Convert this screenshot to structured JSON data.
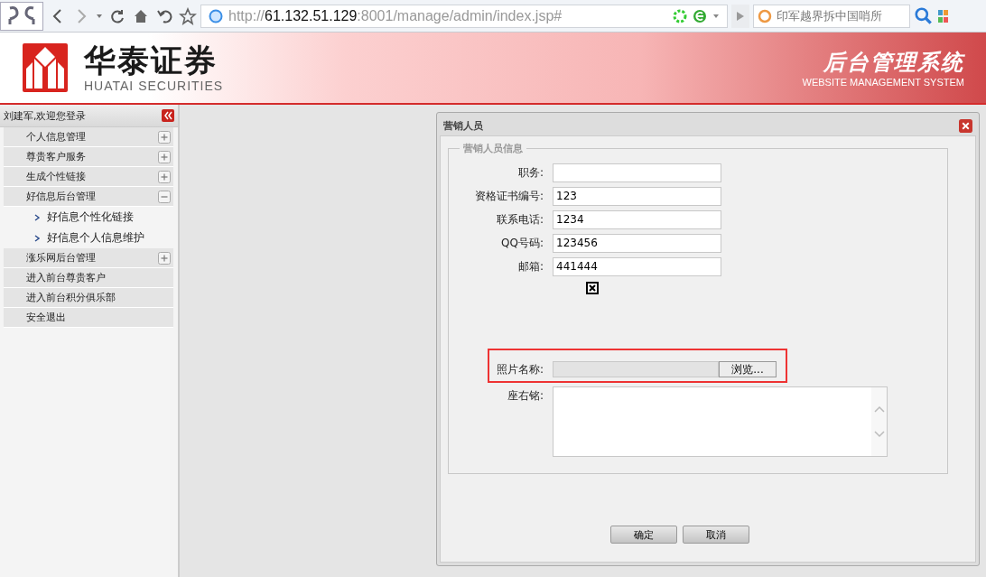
{
  "browser": {
    "url_prefix": "http://",
    "url_host": "61.132.51.129",
    "url_rest": ":8001/manage/admin/index.jsp#",
    "search_placeholder": "印军越界拆中国哨所"
  },
  "header": {
    "brand_cn": "华泰证券",
    "brand_en": "HUATAI SECURITIES",
    "system_cn": "后台管理系统",
    "system_en": "WEBSITE MANAGEMENT SYSTEM"
  },
  "sidebar": {
    "welcome": "刘建军,欢迎您登录",
    "items": [
      {
        "label": "个人信息管理",
        "kind": "group",
        "expanded": false
      },
      {
        "label": "尊贵客户服务",
        "kind": "group",
        "expanded": false
      },
      {
        "label": "生成个性链接",
        "kind": "group",
        "expanded": false
      },
      {
        "label": "好信息后台管理",
        "kind": "group",
        "expanded": true,
        "children": [
          {
            "label": "好信息个性化链接"
          },
          {
            "label": "好信息个人信息维护"
          }
        ]
      },
      {
        "label": "涨乐网后台管理",
        "kind": "group",
        "expanded": false
      },
      {
        "label": "进入前台尊贵客户",
        "kind": "link"
      },
      {
        "label": "进入前台积分俱乐部",
        "kind": "link"
      },
      {
        "label": "安全退出",
        "kind": "link"
      }
    ]
  },
  "dialog": {
    "title": "营销人员",
    "legend": "营销人员信息",
    "fields": [
      {
        "label": "职务:",
        "kind": "text"
      },
      {
        "label": "资格证书编号:",
        "kind": "text",
        "value": "123"
      },
      {
        "label": "联系电话:",
        "kind": "text",
        "value": "1234"
      },
      {
        "label": "QQ号码:",
        "kind": "text",
        "value": "123456"
      },
      {
        "label": "邮箱:",
        "kind": "text",
        "value": "441444"
      },
      {
        "kind": "image"
      },
      {
        "label": "照片名称:",
        "kind": "file",
        "button": "浏览...",
        "highlighted": true
      },
      {
        "label": "座右铭:",
        "kind": "textarea"
      }
    ],
    "buttons": [
      "确定",
      "取消"
    ]
  }
}
